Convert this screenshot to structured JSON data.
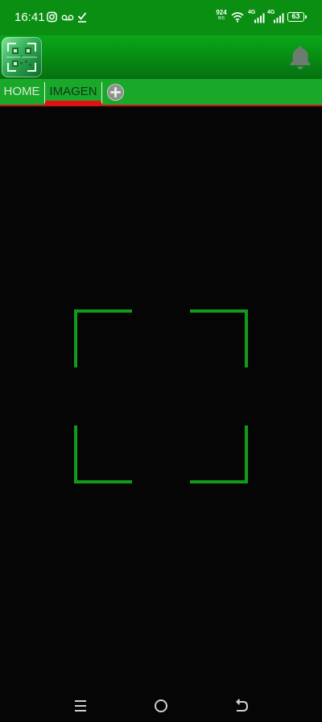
{
  "status_bar": {
    "time": "16:41",
    "net_speed_value": "924",
    "net_speed_unit": "B/S",
    "signal_1_label": "4G",
    "signal_2_label": "4G",
    "battery_level": "63",
    "icons": [
      "instagram-icon",
      "voicemail-icon",
      "download-done-icon",
      "wifi-icon",
      "signal-icon",
      "signal-icon",
      "battery-icon"
    ]
  },
  "header": {
    "logo_icon": "qr-code-logo-icon",
    "notification_icon": "bell-icon"
  },
  "tabs": {
    "items": [
      {
        "label": "HOME",
        "active": false
      },
      {
        "label": "IMAGEN",
        "active": true
      }
    ],
    "add_icon": "add-circle-icon"
  },
  "camera": {
    "frame_color": "#129a1a"
  },
  "nav_bar": {
    "icons": [
      "menu-icon",
      "home-circle-icon",
      "back-icon"
    ]
  },
  "colors": {
    "status_bar": "#0a8f12",
    "header": "#078a14",
    "tabs_bar": "#1aa82a",
    "active_tab_indicator": "#e41010",
    "camera_background": "#050505"
  }
}
